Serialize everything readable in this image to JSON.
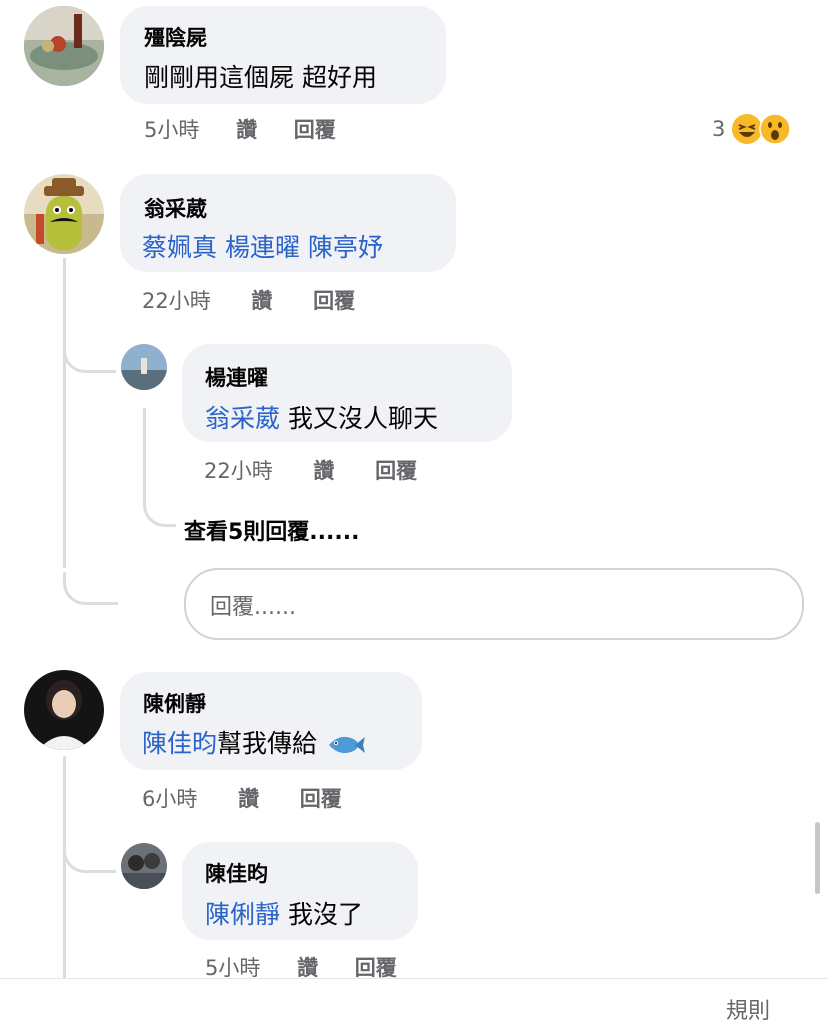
{
  "comments": [
    {
      "author": "殭陰屍",
      "text": "剛剛用這個屍 超好用",
      "time": "5小時",
      "like": "讚",
      "reply": "回覆",
      "reaction_count": "3"
    },
    {
      "author": "翁采葳",
      "mentions": "蔡姵真 楊連曜 陳亭妤",
      "time": "22小時",
      "like": "讚",
      "reply": "回覆",
      "replies": [
        {
          "author": "楊連曜",
          "mention": "翁采葳",
          "text": " 我又沒人聊天",
          "time": "22小時",
          "like": "讚",
          "reply": "回覆"
        }
      ],
      "view_more": "查看5則回覆......",
      "reply_placeholder": "回覆......"
    },
    {
      "author": "陳俐靜",
      "mention": "陳佳昀",
      "text": "幫我傳給",
      "time": "6小時",
      "like": "讚",
      "reply": "回覆",
      "replies": [
        {
          "author": "陳佳昀",
          "mention": "陳俐靜",
          "text": " 我沒了",
          "time": "5小時",
          "like": "讚",
          "reply": "回覆"
        }
      ]
    }
  ],
  "footer": {
    "rules": "規則"
  },
  "reaction_icons": [
    "laughing-emoji-icon",
    "wow-emoji-icon"
  ],
  "colors": {
    "mention": "#2b63c9",
    "bubble": "#f0f2f5",
    "meta": "#65676b"
  }
}
